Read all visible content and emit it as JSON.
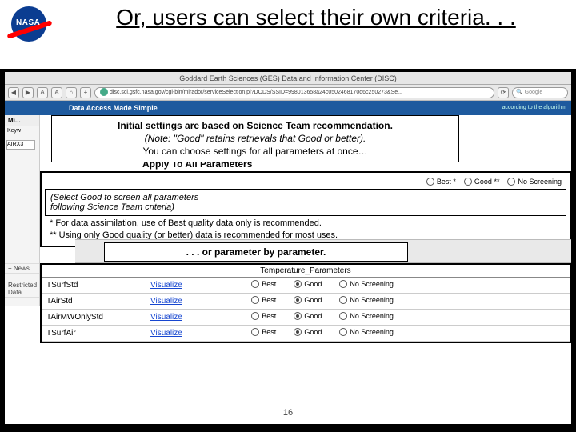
{
  "logo_text": "NASA",
  "title": "Or, users can select their own criteria. . .",
  "browser": {
    "header": "Goddard Earth Sciences (GES) Data and Information Center (DISC)",
    "url": "disc.sci.gsfc.nasa.gov/cgi-bin/mirador/serviceSelection.pl?DODS/SSID=998013658a24c0502468170d6c250273&Se...",
    "search_placeholder": "Google",
    "nav": {
      "back": "◀",
      "fwd": "▶",
      "reload": "⟳",
      "home": "⌂",
      "a1": "A",
      "a2": "A",
      "plus": "+"
    }
  },
  "blue_strip": {
    "left": "Data Access Made Simple",
    "right": "according to the algorithm"
  },
  "sidebar": {
    "head": "Mi...",
    "keyword_label": "Keyw",
    "keyword_value": "AIRX3",
    "items": [
      "+  News",
      "+  Restricted Data",
      "+ "
    ]
  },
  "callout1": {
    "l1": "Initial settings are based on Science Team recommendation.",
    "l2": "(Note: \"Good\" retains retrievals that Good or better).",
    "l3": "You can choose settings for all parameters at once…"
  },
  "overlap_label": "Apply To All Parameters",
  "quality_options": [
    "Best *",
    "Good **",
    "No Screening"
  ],
  "quality_box": {
    "line0": "(Select Good to screen all parameters",
    "line0b": "following Science Team criteria)",
    "line1": "* For data assimilation, use of Best quality data only is recommended.",
    "line2": "** Using only Good quality (or better) data is recommended for most uses."
  },
  "callout2": ". . . or parameter by parameter.",
  "temp_section_head": "Temperature_Parameters",
  "visualize_label": "Visualize",
  "param_options": [
    "Best",
    "Good",
    "No Screening"
  ],
  "params": [
    {
      "name": "TSurfStd",
      "selected": 1
    },
    {
      "name": "TAirStd",
      "selected": 1
    },
    {
      "name": "TAirMWOnlyStd",
      "selected": 1
    },
    {
      "name": "TSurfAir",
      "selected": 1
    }
  ],
  "page_number": "16"
}
